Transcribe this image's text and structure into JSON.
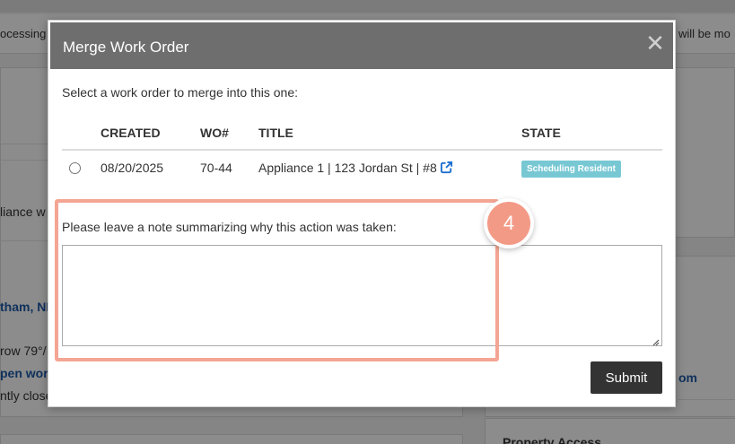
{
  "background": {
    "banner_left_text": "ocessing",
    "banner_right_text": "will be mo",
    "snippet_appliance": "liance w",
    "link_city": "tham, NI",
    "snippet_weather": "row 79°/",
    "link_open_work": "pen work",
    "snippet_closed": "ntly close",
    "link_com": "om",
    "property_access": "Property Access"
  },
  "modal": {
    "title": "Merge Work Order",
    "close_glyph": "✕",
    "instruction": "Select a work order to merge into this one:",
    "columns": [
      "CREATED",
      "WO#",
      "TITLE",
      "STATE"
    ],
    "rows": [
      {
        "created": "08/20/2025",
        "wo": "70-44",
        "title": "Appliance 1 | 123 Jordan St | #8",
        "state": "Scheduling Resident",
        "selected": false
      }
    ],
    "note_label": "Please leave a note summarizing why this action was taken:",
    "note_value": "",
    "submit_label": "Submit"
  },
  "annotation": {
    "step_number": "4",
    "highlight_color": "#f4a593",
    "badge_color": "#f39a86"
  },
  "colors": {
    "header_bg": "#6e6e6e",
    "state_badge_bg": "#78c8d4",
    "link_blue": "#1e6fd0",
    "submit_bg": "#333333"
  }
}
